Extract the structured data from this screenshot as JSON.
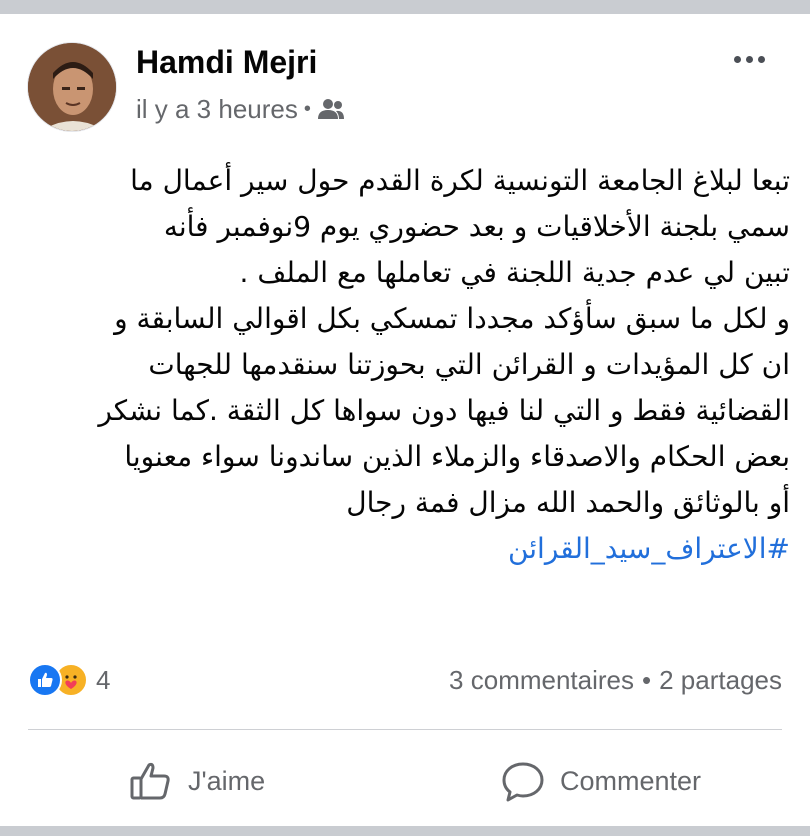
{
  "post": {
    "author": "Hamdi Mejri",
    "timestamp": "il y a 3 heures",
    "separator": "•",
    "audience_icon": "friends-icon",
    "body_lines": [
      "تبعا لبلاغ الجامعة  التونسية لكرة القدم حول سير أعمال ما",
      "سمي بلجنة الأخلاقيات و بعد حضوري يوم 9نوفمبر فأنه",
      "تبين لي عدم جدية اللجنة في تعاملها مع الملف .",
      "و لكل ما سبق سأؤكد مجددا تمسكي بكل اقوالي السابقة و",
      "ان كل المؤيدات و القرائن التي بحوزتنا سنقدمها للجهات",
      "القضائية فقط و التي لنا فيها دون سواها كل الثقة .كما نشكر",
      "بعض الحكام  والاصدقاء والزملاء الذين ساندونا سواء معنويا",
      "أو بالوثائق والحمد الله مزال فمة رجال"
    ],
    "hashtag": "#الاعتراف_سيد_القرائن"
  },
  "reactions": {
    "types": [
      "like-icon",
      "care-icon"
    ],
    "count": "4"
  },
  "engagement": {
    "comments": "3 commentaires",
    "separator": "•",
    "shares": "2 partages"
  },
  "actions": {
    "like_label": "J'aime",
    "comment_label": "Commenter"
  },
  "colors": {
    "link": "#216fdb",
    "secondary_text": "#65676b",
    "like_blue": "#1877f2",
    "care_yellow": "#f7b125",
    "frame_gray": "#c9ccd1"
  }
}
